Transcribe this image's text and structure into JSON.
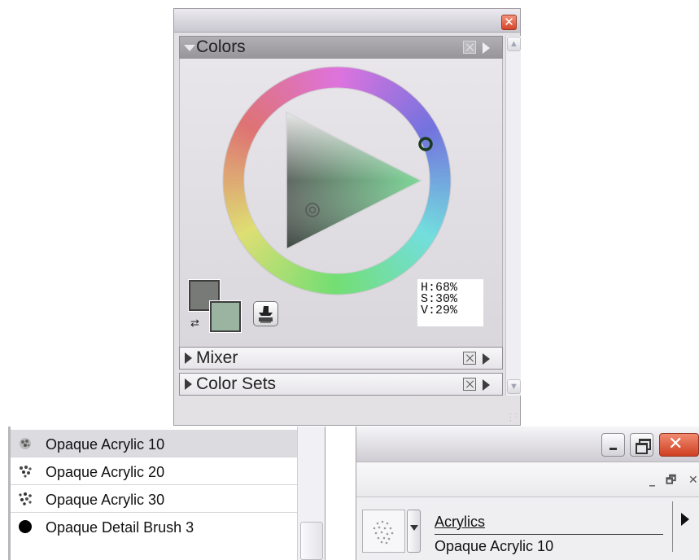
{
  "colors_panel": {
    "close_glyph": "✕",
    "sections": {
      "colors": {
        "title": "Colors"
      },
      "mixer": {
        "title": "Mixer"
      },
      "color_sets": {
        "title": "Color Sets"
      }
    },
    "hsv": {
      "h_label": "H:68%",
      "s_label": "S:30%",
      "v_label": "V:29%",
      "h": 0.68,
      "s": 0.3,
      "v": 0.29
    },
    "main_color": "#787a78",
    "additional_color": "#9bb4a2",
    "icons": [
      "close-icon",
      "collapse-triangle-icon",
      "expand-triangle-icon",
      "section-close-icon",
      "section-menu-icon",
      "scroll-up-icon",
      "scroll-down-icon",
      "swap-colors-icon",
      "clone-color-stamp-icon",
      "resize-grip-icon"
    ]
  },
  "brush_list": {
    "items": [
      {
        "label": "Opaque Acrylic 10",
        "icon": "brush-dab-icon",
        "selected": true
      },
      {
        "label": "Opaque Acrylic 20",
        "icon": "brush-dab-icon",
        "selected": false
      },
      {
        "label": "Opaque Acrylic 30",
        "icon": "brush-dab-icon",
        "selected": false
      },
      {
        "label": "Opaque Detail Brush 3",
        "icon": "round-dab-icon",
        "selected": false
      }
    ]
  },
  "brush_selector": {
    "category": "Acrylics",
    "variant": "Opaque Acrylic 10",
    "window_close_glyph": "✕",
    "mini_buttons": {
      "minimize": "_",
      "maximize": "🗗",
      "close": "✕"
    }
  },
  "colors": {
    "accent_close": "#d4452a",
    "panel_bg": "#e3e1e4",
    "section_header": "#989699"
  }
}
